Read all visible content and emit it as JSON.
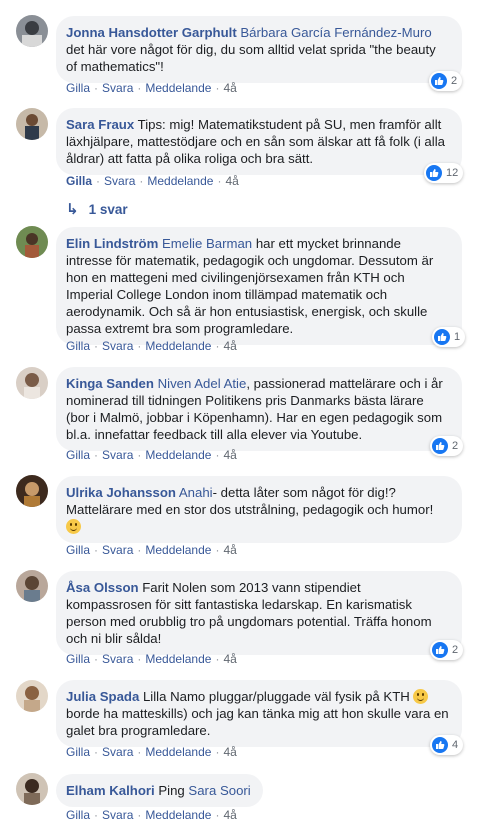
{
  "actions": {
    "like": "Gilla",
    "reply": "Svara",
    "message": "Meddelande",
    "dot": "·"
  },
  "comments": [
    {
      "author": "Jonna Hansdotter Garphult",
      "tag": "Bárbara García Fernández-Muro",
      "text": "det här vore något för dig, du som alltid velat sprida \"the beauty of mathematics\"!",
      "time": "4å",
      "likes": "2",
      "liked": false
    },
    {
      "author": "Sara Fraux",
      "tag": "",
      "text": "Tips: mig! Matematikstudent på SU, men framför allt läxhjälpare, mattestödjare och en sån som älskar att få folk (i alla åldrar) att fatta på olika roliga och bra sätt.",
      "time": "4å",
      "likes": "12",
      "liked": true
    },
    {
      "author": "Elin Lindström",
      "tag": "Emelie Barman",
      "text": "har ett mycket brinnande intresse för matematik, pedagogik och ungdomar. Dessutom är hon en mattegeni med civilingenjörsexamen från KTH och Imperial College London inom tillämpad matematik och aerodynamik. Och så är hon entusiastisk, energisk, och skulle passa extremt bra som programledare.",
      "time": "4å",
      "likes": "1",
      "liked": false
    },
    {
      "author": "Kinga Sanden",
      "tag": "Niven Adel Atie",
      "text": ", passionerad mattelärare och i år nominerad till tidningen Politikens pris Danmarks bästa lärare (bor i Malmö, jobbar i Köpenhamn). Har en egen pedagogik som bl.a. innefattar feedback till alla elever via Youtube.",
      "time": "4å",
      "likes": "2",
      "liked": false
    },
    {
      "author": "Ulrika Johansson",
      "tag": "Anahi",
      "text": "- detta låter som något för dig!? Mattelärare med en stor dos utstrålning, pedagogik och humor!",
      "time": "4å",
      "likes": "",
      "liked": false
    },
    {
      "author": "Åsa Olsson",
      "tag": "",
      "text": "Farit Nolen som 2013 vann stipendiet kompassrosen för sitt fantastiska ledarskap. En karismatisk person med orubblig tro på ungdomars potential. Träffa honom och ni blir sålda!",
      "time": "4å",
      "likes": "2",
      "liked": false
    },
    {
      "author": "Julia Spada",
      "tag": "",
      "text": "Lilla Namo pluggar/pluggade väl fysik på KTH",
      "text2": "borde ha matteskills) och jag kan tänka mig att hon skulle vara en galet bra programledare.",
      "time": "4å",
      "likes": "4",
      "liked": false
    },
    {
      "author": "Elham Kalhori",
      "tag": "Sara Soori",
      "text_pre": "Ping",
      "time": "4å",
      "likes": "",
      "liked": false
    }
  ],
  "replies": {
    "label": "1 svar"
  },
  "colors": {
    "link": "#385898",
    "bubble": "#f2f3f5",
    "like_blue": "#1877f2"
  }
}
